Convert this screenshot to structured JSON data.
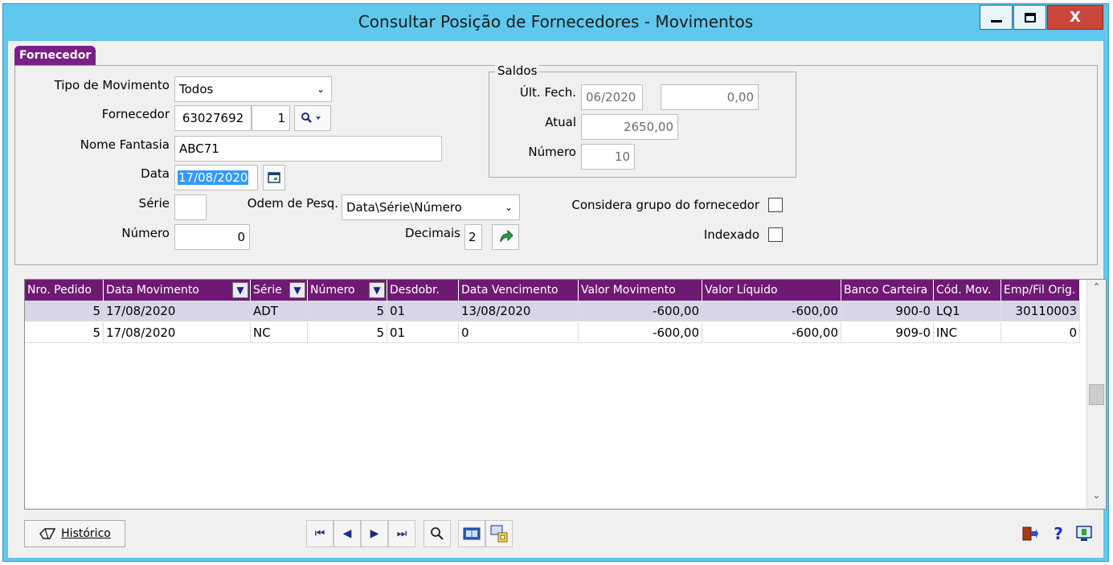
{
  "window": {
    "title": "Consultar Posição de Fornecedores - Movimentos",
    "close_label": "X"
  },
  "tab": {
    "label": "Fornecedor"
  },
  "form": {
    "tipo_movimento": {
      "label": "Tipo de Movimento",
      "value": "Todos"
    },
    "fornecedor": {
      "label": "Fornecedor",
      "code": "63027692",
      "branch": "1"
    },
    "nome_fantasia": {
      "label": "Nome Fantasia",
      "value": "ABC71"
    },
    "data": {
      "label": "Data",
      "value": "17/08/2020"
    },
    "serie": {
      "label": "Série",
      "value": ""
    },
    "ordem": {
      "label": "Odem de Pesq.",
      "value": "Data\\Série\\Número"
    },
    "numero": {
      "label": "Número",
      "value": "0"
    },
    "decimais": {
      "label": "Decimais",
      "value": "2"
    },
    "considera_grupo": {
      "label": "Considera grupo do fornecedor",
      "checked": false
    },
    "indexado": {
      "label": "Indexado",
      "checked": false
    }
  },
  "saldos": {
    "title": "Saldos",
    "ult_fech": {
      "label": "Últ. Fech.",
      "date": "06/2020",
      "value": "0,00"
    },
    "atual": {
      "label": "Atual",
      "value": "2650,00"
    },
    "numero": {
      "label": "Número",
      "value": "10"
    }
  },
  "grid": {
    "headers": [
      "Nro. Pedido",
      "Data Movimento",
      "Série",
      "Número",
      "Desdobr.",
      "Data Vencimento",
      "Valor Movimento",
      "Valor Líquido",
      "Banco Carteira",
      "Cód. Mov.",
      "Emp/Fil Orig."
    ],
    "rows": [
      [
        "5",
        "17/08/2020",
        "ADT",
        "5",
        "01",
        "13/08/2020",
        "-600,00",
        "-600,00",
        "900-0",
        "LQ1",
        "30110003"
      ],
      [
        "5",
        "17/08/2020",
        "NC",
        "5",
        "01",
        "0",
        "-600,00",
        "-600,00",
        "909-0",
        "INC",
        "0"
      ]
    ]
  },
  "footer": {
    "historico_label": "Histórico"
  },
  "icons": {
    "search": "magnifier-icon",
    "calendar": "calendar-icon",
    "refresh": "green-arrow-icon",
    "exit": "exit-door-icon",
    "help": "help-icon"
  }
}
